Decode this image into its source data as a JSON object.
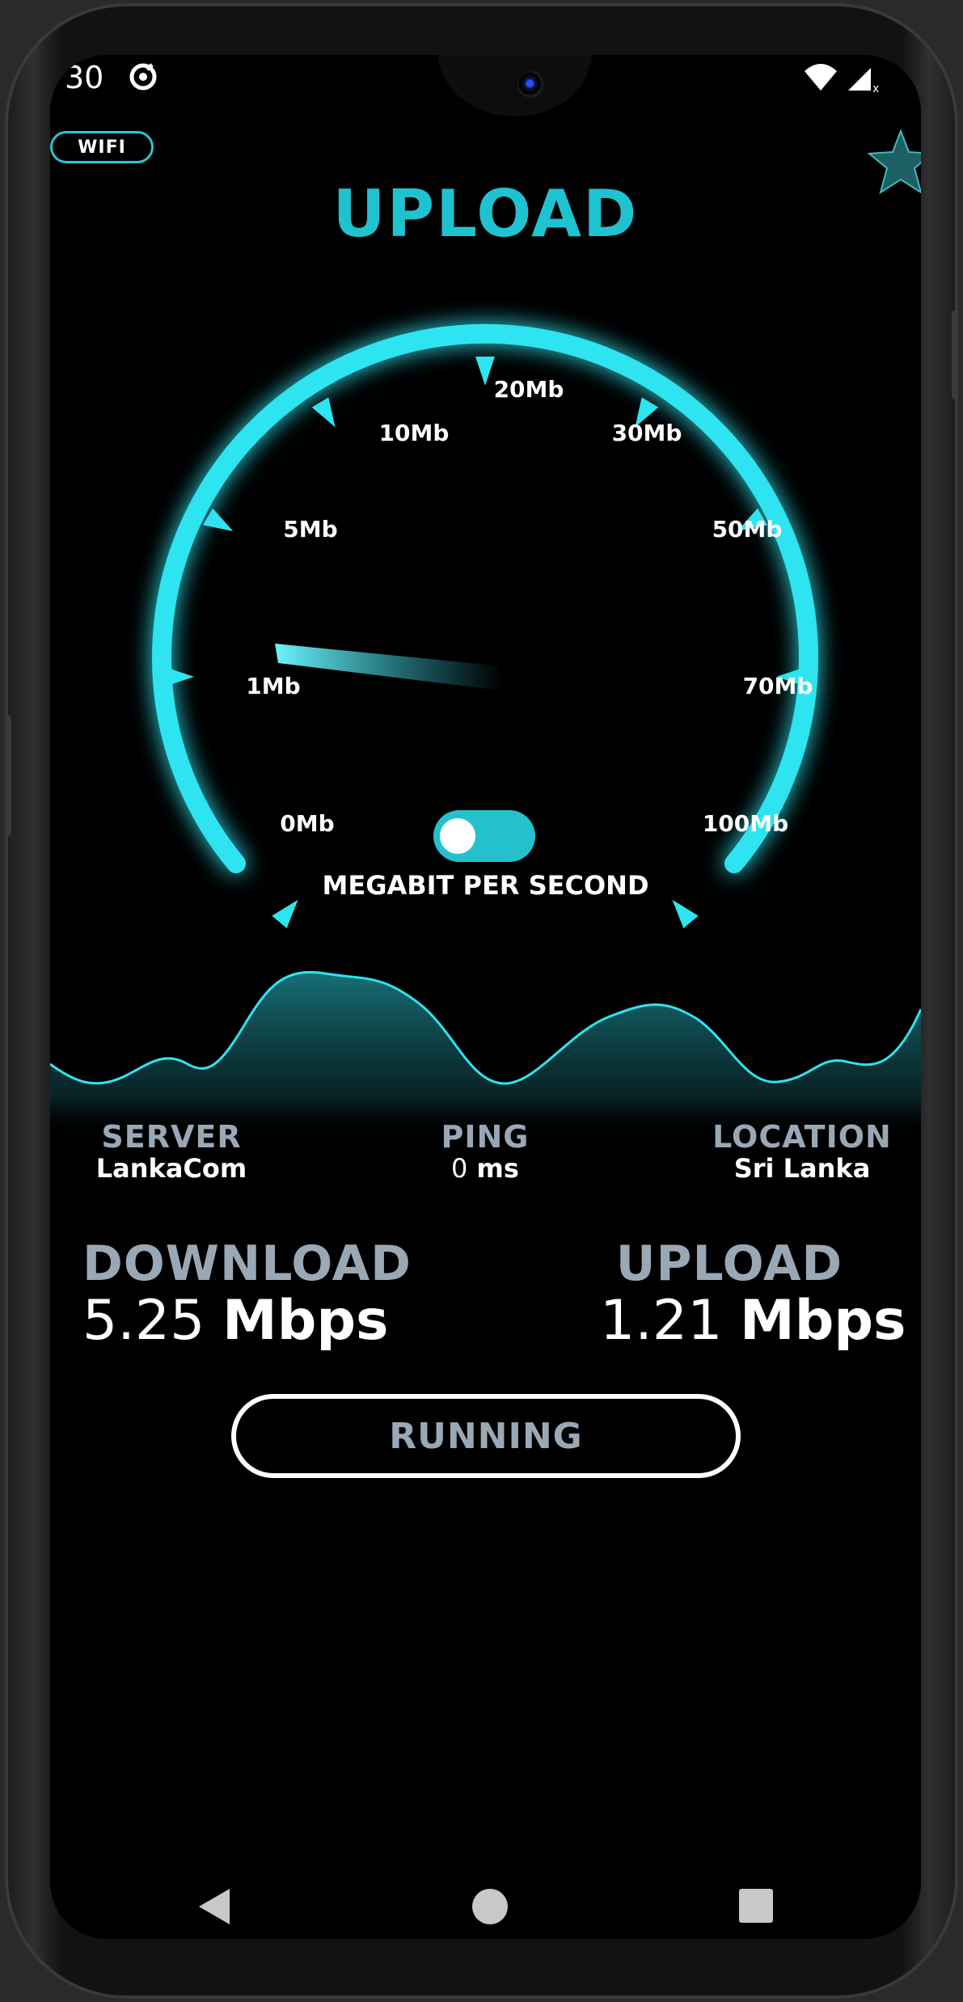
{
  "status_bar": {
    "time": "30"
  },
  "connection_badge": "WIFI",
  "title": "UPLOAD",
  "gauge": {
    "labels": [
      "0Mb",
      "1Mb",
      "5Mb",
      "10Mb",
      "20Mb",
      "30Mb",
      "50Mb",
      "70Mb",
      "100Mb"
    ],
    "needle_at_label": "1Mb",
    "accent": "#2ee4f0"
  },
  "unit_label": "MEGABIT PER SECOND",
  "info": {
    "server_label": "SERVER",
    "server_value": "LankaCom",
    "ping_label": "PING",
    "ping_value": "0",
    "ping_unit": "ms",
    "location_label": "LOCATION",
    "location_value": "Sri Lanka"
  },
  "download": {
    "label": "DOWNLOAD",
    "value": "5.25",
    "unit": "Mbps"
  },
  "upload": {
    "label": "UPLOAD",
    "value": "1.21",
    "unit": "Mbps"
  },
  "action_button": "RUNNING",
  "colors": {
    "accent": "#1fc3d0",
    "muted": "#9aa8b6"
  }
}
